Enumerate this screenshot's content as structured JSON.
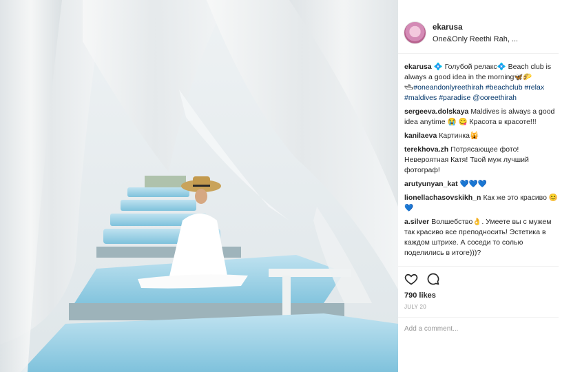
{
  "colors": {
    "link": "#003569",
    "text": "#262626",
    "muted": "#999999",
    "border": "#efefef"
  },
  "photo": {
    "description_icon": "image-photo"
  },
  "header": {
    "username": "ekarusa",
    "location": "One&Only Reethi Rah, ..."
  },
  "comments": [
    {
      "user": "ekarusa",
      "parts": [
        {
          "text": "💠 Голубой релакс💠 Beach club is always a good idea in the morning🦋🌮\n🛥",
          "tag": false
        },
        {
          "text": "#oneandonlyreethirah #beachclub #relax #maldives #paradise @ooreethirah",
          "tag": true
        }
      ]
    },
    {
      "user": "sergeeva.dolskaya",
      "parts": [
        {
          "text": "Maldives is always a good idea anytime 😭 😋 Красота в красоте!!!",
          "tag": false
        }
      ]
    },
    {
      "user": "kanilaeva",
      "parts": [
        {
          "text": "Картинка🙀",
          "tag": false
        }
      ]
    },
    {
      "user": "terekhova.zh",
      "parts": [
        {
          "text": "Потрясающее фото! Невероятная Катя! Твой муж лучший фотограф!",
          "tag": false
        }
      ]
    },
    {
      "user": "arutyunyan_kat",
      "parts": [
        {
          "text": "💙💙💙",
          "tag": false
        }
      ]
    },
    {
      "user": "lionellachasovskikh_n",
      "parts": [
        {
          "text": "Как же это красиво 😊💙",
          "tag": false
        }
      ]
    },
    {
      "user": "a.silver",
      "parts": [
        {
          "text": "Волшебство👌. Умеете вы с мужем так красиво все преподносить! Эстетика в каждом штрихе. А соседи то солью поделились в итоге)))?",
          "tag": false
        }
      ]
    }
  ],
  "actions": {
    "like_icon": "heart-icon",
    "comment_icon": "speech-bubble-icon"
  },
  "likes_text": "790 likes",
  "date_text": "JULY 20",
  "add_comment_placeholder": "Add a comment..."
}
